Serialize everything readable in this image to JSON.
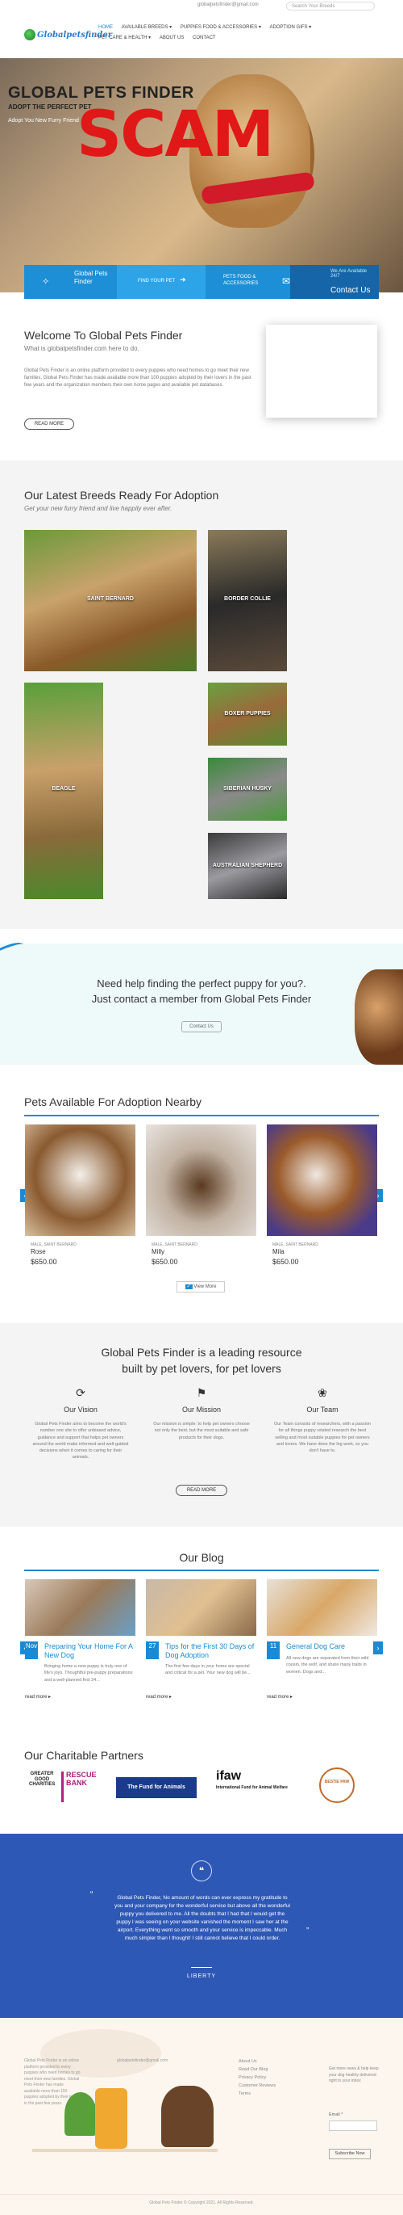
{
  "topbar": {
    "email": "globalpetsfinder@gmail.com",
    "search_placeholder": "Search Your Breeds"
  },
  "header": {
    "logo": "Globalpetsfinder",
    "nav": [
      "Home",
      "Available Breeds ▾",
      "Puppies Food & Accessories ▾",
      "Adoption Gifs ▾",
      "Pet Care & Health ▾",
      "About Us",
      "Contact"
    ]
  },
  "hero": {
    "title": "GLOBAL PETS FINDER",
    "subtitle": "ADOPT THE PERFECT PET",
    "tagline": "Adopt You New Furry Friend",
    "overlay": "SCAM"
  },
  "strip": {
    "s1": "Global Pets Finder",
    "s2": "Find your pet",
    "s3": "Pets food & accessories",
    "s4_small": "We Are Available 24/7",
    "s4": "Contact Us"
  },
  "welcome": {
    "title": "Welcome To Global Pets Finder",
    "sub": "What is globalpetsfinder.com here to do.",
    "body": "Global Pets Finder is an online platform provided to every puppies who need homes to go meet their new families. Global Pets Finder has made available more than 100 puppies adopted by their lovers in the past few years and the organization members their own home pages and available pet databases.",
    "btn": "READ MORE"
  },
  "breeds": {
    "title": "Our Latest Breeds Ready For Adoption",
    "sub": "Get your new furry friend and live happily ever after.",
    "items": [
      "SAINT BERNARD",
      "BORDER COLLIE",
      "BEAGLE",
      "BOXER PUPPIES",
      "SIBERIAN HUSKY",
      "AUSTRALIAN SHEPHERD"
    ]
  },
  "cta": {
    "line1": "Need help finding the perfect puppy for you?.",
    "line2": "Just contact a member from Global Pets Finder",
    "btn": "Contact Us"
  },
  "nearby": {
    "title": "Pets Available For Adoption Nearby",
    "items": [
      {
        "tag": "MALE, SAINT BERNARD",
        "name": "Rose",
        "price": "$650.00"
      },
      {
        "tag": "MALE, SAINT BERNARD",
        "name": "Milly",
        "price": "$650.00"
      },
      {
        "tag": "MALE, SAINT BERNARD",
        "name": "Mila",
        "price": "$650.00"
      }
    ],
    "btn": "View More"
  },
  "mission": {
    "title1": "Global Pets Finder is a leading resource",
    "title2": "built by pet lovers, for pet lovers",
    "cols": [
      {
        "h": "Our Vision",
        "t": "Global Pets Finder aims to become the world's number one site to offer unbiased advice, guidance and support that helps pet owners around the world make informed and well-guided decisions when it comes to caring for their animals."
      },
      {
        "h": "Our Mission",
        "t": "Our mission is simple: to help pet owners choose not only the best, but the most suitable and safe products for their dogs."
      },
      {
        "h": "Our Team",
        "t": "Our Team consists of researchers, with a passion for all things puppy related research the best selling and most suitable puppies for pet owners and lovers. We have done the leg work, so you don't have to."
      }
    ],
    "btn": "READ MORE"
  },
  "blog": {
    "title": "Our Blog",
    "posts": [
      {
        "day": "Nov",
        "title": "Preparing Your Home For A New Dog",
        "text": "Bringing home a new puppy is truly one of life's joys. Thoughtful pre-puppy preparations and a well-planned first 24...",
        "more": "read more ▸"
      },
      {
        "day": "27",
        "title": "Tips for the First 30 Days of Dog Adoption",
        "text": "The first few days in your home are special and critical for a pet. Your new dog will be...",
        "more": "read more ▸"
      },
      {
        "day": "11",
        "title": "General Dog Care",
        "text": "All new dogs are separated from their wild cousin, the wolf, and share many traits in women. Dogs and...",
        "more": "read more ▸"
      }
    ]
  },
  "partners": {
    "title": "Our Charitable Partners",
    "logos": [
      "GREATER GOOD CHARITIES",
      "RESCUE BANK",
      "The Fund for Animals",
      "ifaw",
      "BESTIE PAW"
    ]
  },
  "testimonial": {
    "text": "Global Pets Finder, No amount of words can ever express my gratitude to you and your company for the wonderful service but above all the wonderful puppy you delivered to me. All the doubts that I had that I would get the puppy I was seeing on your website vanished the moment I saw her at the airport. Everything went so smooth and your service is impeccable. Much much simpler than I thought! I still cannot believe that I could order.",
    "name": "LIBERTY"
  },
  "footer": {
    "about": "Global Pets Finder is an online platform provided to every puppies who need homes to go meet their new families. Global Pets Finder has made available more than 100 puppies adopted by their lovers in the past few years.",
    "email": "globalpetsfinder@gmail.com",
    "links": [
      "About Us",
      "Read Our Blog",
      "Privacy Policy",
      "Customer Reviews",
      "Terms"
    ],
    "news": "Get more news & help keep your dog healthy delivered right to your inbox",
    "email_label": "Email *",
    "btn": "Subscribe Now",
    "copyright": "Global Pets Finder © Copyright 2021. All Rights Reserved."
  },
  "colors": {
    "accent": "#1a8ad4",
    "scam": "#e11818",
    "testimonial": "#2e58b6"
  }
}
